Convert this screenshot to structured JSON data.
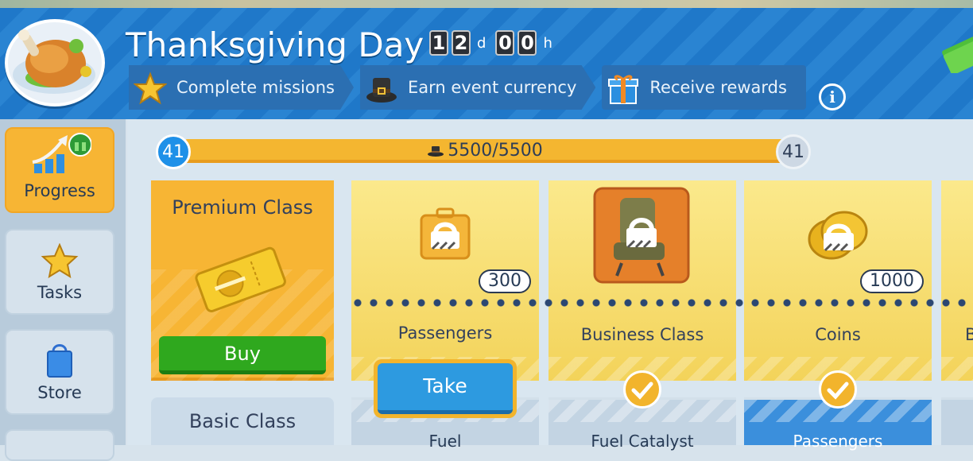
{
  "header": {
    "title": "Thanksgiving Day",
    "timer": {
      "days": [
        "1",
        "2"
      ],
      "day_unit": "d",
      "hours": [
        "0",
        "0"
      ],
      "hour_unit": "h"
    },
    "steps": [
      {
        "label": "Complete missions",
        "icon": "star-icon"
      },
      {
        "label": "Earn event currency",
        "icon": "pilgrim-hat-icon"
      },
      {
        "label": "Receive rewards",
        "icon": "gift-icon"
      }
    ],
    "info_label": "i"
  },
  "sidebar": {
    "items": [
      {
        "label": "Progress",
        "icon": "progress-arrow-icon",
        "active": true
      },
      {
        "label": "Tasks",
        "icon": "star-icon"
      },
      {
        "label": "Store",
        "icon": "shopping-bag-icon"
      }
    ]
  },
  "progress": {
    "current_level": "41",
    "next_level": "41",
    "points_text": "5500/5500",
    "fraction": 1.0
  },
  "tracks": {
    "premium": {
      "title": "Premium Class",
      "buy_label": "Buy"
    },
    "basic": {
      "title": "Basic Class"
    }
  },
  "rewards": [
    {
      "label": "Passengers",
      "qty": "300",
      "icon": "suitcase-icon",
      "locked": true
    },
    {
      "label": "Business Class",
      "qty": "",
      "icon": "seat-icon",
      "locked": true
    },
    {
      "label": "Coins",
      "qty": "1000",
      "icon": "coins-icon",
      "locked": true
    },
    {
      "label": "B",
      "qty": "",
      "icon": "",
      "locked": true
    }
  ],
  "basic_rewards": [
    {
      "label": "Fuel",
      "action": "Take"
    },
    {
      "label": "Fuel Catalyst",
      "status": "claimed"
    },
    {
      "label": "Passengers",
      "status": "claimed"
    }
  ],
  "colors": {
    "accent": "#f7b534",
    "header_blue": "#1f78c9",
    "buy_green": "#2fa81e",
    "take_blue": "#2d9ae0"
  }
}
